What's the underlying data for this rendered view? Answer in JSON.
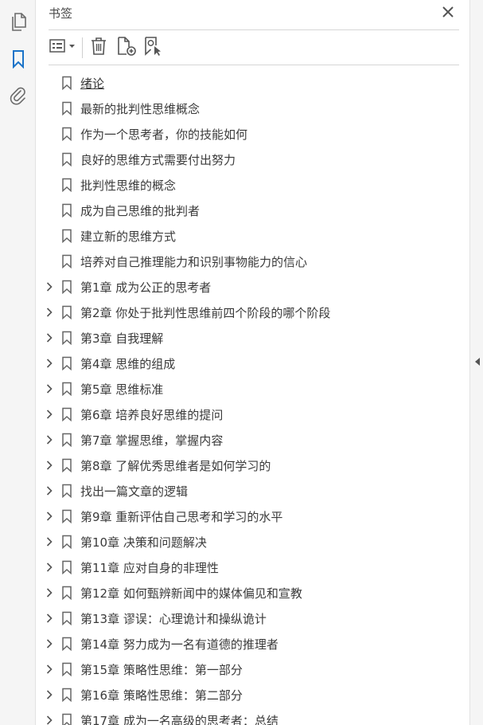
{
  "panel": {
    "title": "书签"
  },
  "rail": {
    "items": [
      {
        "icon": "page-thumbnails-icon"
      },
      {
        "icon": "bookmark-icon",
        "active": true
      },
      {
        "icon": "paperclip-icon"
      }
    ]
  },
  "toolbar": {
    "options_icon": "options-menu-icon",
    "delete_icon": "trash-icon",
    "new_bookmark_icon": "new-bookmark-icon",
    "find_bookmark_icon": "find-current-bookmark-icon"
  },
  "colors": {
    "accent": "#1a73c8",
    "icon_gray": "#6b6b6b",
    "scroll_thumb": "#c2c2c2"
  },
  "bookmarks": [
    {
      "label": "绪论",
      "expandable": false,
      "current": true
    },
    {
      "label": "最新的批判性思维概念",
      "expandable": false
    },
    {
      "label": "作为一个思考者，你的技能如何",
      "expandable": false
    },
    {
      "label": "良好的思维方式需要付出努力",
      "expandable": false
    },
    {
      "label": "批判性思维的概念",
      "expandable": false
    },
    {
      "label": "成为自己思维的批判者",
      "expandable": false
    },
    {
      "label": "建立新的思维方式",
      "expandable": false
    },
    {
      "label": "培养对自己推理能力和识别事物能力的信心",
      "expandable": false
    },
    {
      "label": "第1章 成为公正的思考者",
      "expandable": true
    },
    {
      "label": "第2章 你处于批判性思维前四个阶段的哪个阶段",
      "expandable": true
    },
    {
      "label": "第3章 自我理解",
      "expandable": true
    },
    {
      "label": "第4章 思维的组成",
      "expandable": true
    },
    {
      "label": "第5章 思维标准",
      "expandable": true
    },
    {
      "label": "第6章 培养良好思维的提问",
      "expandable": true
    },
    {
      "label": "第7章 掌握思维，掌握内容",
      "expandable": true
    },
    {
      "label": "第8章 了解优秀思维者是如何学习的",
      "expandable": true
    },
    {
      "label": "找出一篇文章的逻辑",
      "expandable": true
    },
    {
      "label": "第9章 重新评估自己思考和学习的水平",
      "expandable": true
    },
    {
      "label": "第10章 决策和问题解决",
      "expandable": true
    },
    {
      "label": "第11章 应对自身的非理性",
      "expandable": true
    },
    {
      "label": "第12章 如何甄辨新闻中的媒体偏见和宣教",
      "expandable": true
    },
    {
      "label": "第13章 谬误：心理诡计和操纵诡计",
      "expandable": true
    },
    {
      "label": "第14章 努力成为一名有道德的推理者",
      "expandable": true
    },
    {
      "label": "第15章 策略性思维：第一部分",
      "expandable": true
    },
    {
      "label": "第16章 策略性思维：第二部分",
      "expandable": true
    },
    {
      "label": "第17章 成为一名高级的思考者：总结",
      "expandable": true
    }
  ]
}
